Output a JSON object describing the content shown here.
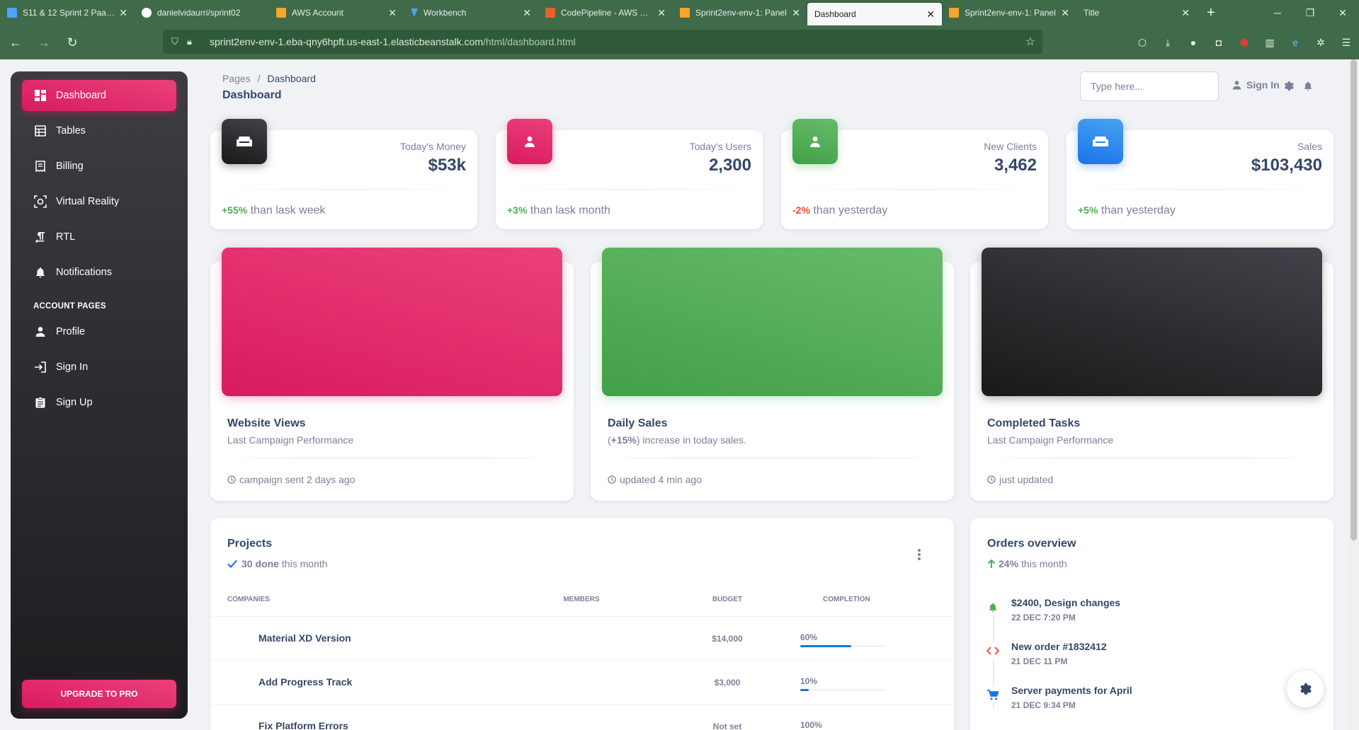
{
  "browser": {
    "tabs": [
      {
        "label": "S11 & 12 Sprint 2 PaaS (",
        "icon": "vscode-icon",
        "color": "#4ea4ff",
        "active": false
      },
      {
        "label": "danielvidaurri/sprint02",
        "icon": "github-icon",
        "color": "#ffffff",
        "active": false
      },
      {
        "label": "AWS Account",
        "icon": "aws-box-icon",
        "color": "#f7a52c",
        "active": false
      },
      {
        "label": "Workbench",
        "icon": "vocareum-icon",
        "color": "#5aa0e8",
        "active": false
      },
      {
        "label": "CodePipeline - AWS Dev",
        "icon": "codepipeline-icon",
        "color": "#e4622b",
        "active": false
      },
      {
        "label": "Sprint2env-env-1: Panel",
        "icon": "aws-box-icon",
        "color": "#f7a52c",
        "active": false
      },
      {
        "label": "Dashboard",
        "icon": "none",
        "color": "#ffffff",
        "active": true
      },
      {
        "label": "Sprint2env-env-1: Panel",
        "icon": "aws-box-icon",
        "color": "#f7a52c",
        "active": false
      },
      {
        "label": "Title",
        "icon": "none",
        "color": "#ffffff",
        "active": false
      }
    ],
    "url_host": "sprint2env-env-1.eba-qny6hpft.us-east-1.elasticbeanstalk.com",
    "url_path": "/html/dashboard.html",
    "new_tab": "+"
  },
  "sidebar": {
    "items": [
      {
        "label": "Dashboard",
        "icon": "dashboard-icon",
        "active": true
      },
      {
        "label": "Tables",
        "icon": "table-icon",
        "active": false
      },
      {
        "label": "Billing",
        "icon": "receipt-icon",
        "active": false
      },
      {
        "label": "Virtual Reality",
        "icon": "view-in-ar-icon",
        "active": false
      },
      {
        "label": "RTL",
        "icon": "format-textdirection-r-to-l-icon",
        "active": false
      },
      {
        "label": "Notifications",
        "icon": "bell-icon",
        "active": false
      }
    ],
    "section_label": "ACCOUNT PAGES",
    "account_items": [
      {
        "label": "Profile",
        "icon": "person-icon"
      },
      {
        "label": "Sign In",
        "icon": "login-icon"
      },
      {
        "label": "Sign Up",
        "icon": "assignment-icon"
      }
    ],
    "upgrade_label": "UPGRADE TO PRO"
  },
  "header": {
    "breadcrumb_root": "Pages",
    "breadcrumb_sep": "/",
    "breadcrumb_current": "Dashboard",
    "title": "Dashboard",
    "search_placeholder": "Type here...",
    "signin_label": "Sign In"
  },
  "stats": [
    {
      "label": "Today's Money",
      "value": "$53k",
      "change": "+55%",
      "change_type": "pos",
      "suffix": " than lask week",
      "icon": "weekend-icon",
      "color": "dark"
    },
    {
      "label": "Today's Users",
      "value": "2,300",
      "change": "+3%",
      "change_type": "pos",
      "suffix": " than lask month",
      "icon": "person-icon",
      "color": "pink"
    },
    {
      "label": "New Clients",
      "value": "3,462",
      "change": "-2%",
      "change_type": "neg",
      "suffix": " than yesterday",
      "icon": "person-icon",
      "color": "green"
    },
    {
      "label": "Sales",
      "value": "$103,430",
      "change": "+5%",
      "change_type": "pos",
      "suffix": " than yesterday",
      "icon": "weekend-icon",
      "color": "blue"
    }
  ],
  "charts": [
    {
      "title": "Website Views",
      "subtitle": "Last Campaign Performance",
      "footer": "campaign sent 2 days ago",
      "color": "pink"
    },
    {
      "title": "Daily Sales",
      "subtitle_pre": "(",
      "subtitle_bold": "+15%",
      "subtitle_post": ") increase in today sales.",
      "footer": "updated 4 min ago",
      "color": "green"
    },
    {
      "title": "Completed Tasks",
      "subtitle": "Last Campaign Performance",
      "footer": "just updated",
      "color": "dark"
    }
  ],
  "projects": {
    "title": "Projects",
    "done_bold": "30 done",
    "done_rest": "this month",
    "columns": [
      "COMPANIES",
      "MEMBERS",
      "BUDGET",
      "COMPLETION"
    ],
    "rows": [
      {
        "name": "Material XD Version",
        "budget": "$14,000",
        "completion": "60%",
        "completion_value": 60
      },
      {
        "name": "Add Progress Track",
        "budget": "$3,000",
        "completion": "10%",
        "completion_value": 10
      },
      {
        "name": "Fix Platform Errors",
        "budget": "Not set",
        "completion": "100%",
        "completion_value": 100
      }
    ]
  },
  "orders": {
    "title": "Orders overview",
    "growth_bold": "24%",
    "growth_rest": "this month",
    "items": [
      {
        "text": "$2400, Design changes",
        "date": "22 DEC 7:20 PM",
        "icon": "bell-icon",
        "color": "#4caf50"
      },
      {
        "text": "New order #1832412",
        "date": "21 DEC 11 PM",
        "icon": "code-icon",
        "color": "#f44335"
      },
      {
        "text": "Server payments for April",
        "date": "21 DEC 9:34 PM",
        "icon": "cart-icon",
        "color": "#1a73e8"
      }
    ]
  },
  "colors": {
    "pink": "#e91e63",
    "green": "#4caf50",
    "dark": "#191919",
    "blue": "#1a73e8",
    "text_dark": "#344767",
    "text_muted": "#7b809a"
  }
}
